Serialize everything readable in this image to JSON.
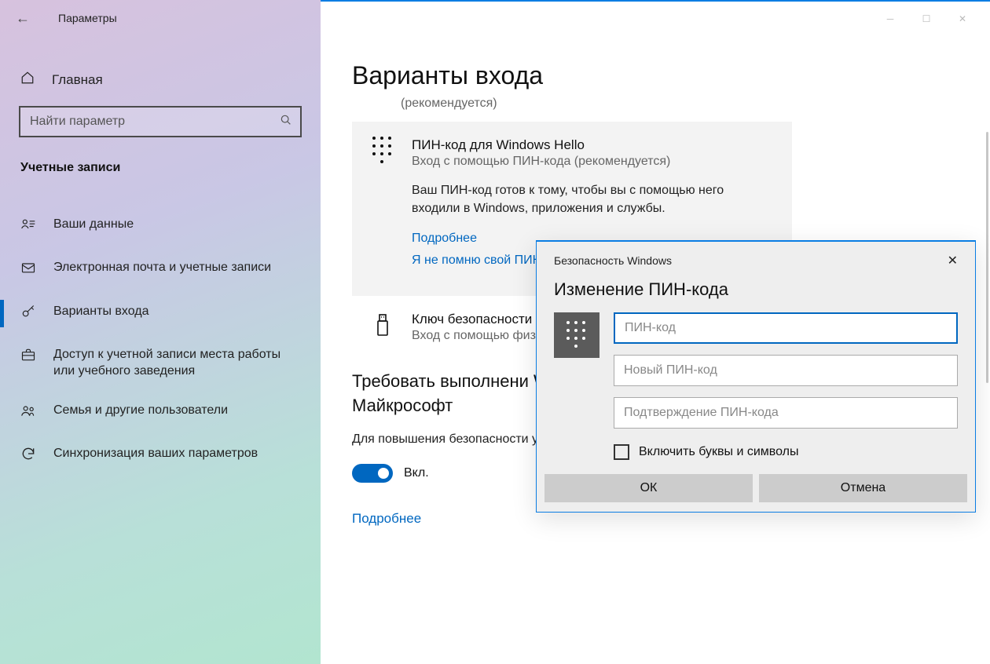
{
  "titlebar": {
    "app_title": "Параметры"
  },
  "sidebar": {
    "home_label": "Главная",
    "search_placeholder": "Найти параметр",
    "section_header": "Учетные записи",
    "items": [
      {
        "label": "Ваши данные"
      },
      {
        "label": "Электронная почта и учетные записи"
      },
      {
        "label": "Варианты входа"
      },
      {
        "label": "Доступ к учетной записи места работы или учебного заведения"
      },
      {
        "label": "Семья и другие пользователи"
      },
      {
        "label": "Синхронизация ваших параметров"
      }
    ]
  },
  "main": {
    "page_title": "Варианты входа",
    "recommended_label": "(рекомендуется)",
    "pin_card": {
      "title": "ПИН-код для Windows Hello",
      "subtitle": "Вход с помощью ПИН-кода (рекомендуется)",
      "description": "Ваш ПИН-код готов к тому, чтобы вы с помощью него входили в Windows, приложения и службы.",
      "learn_more": "Подробнее",
      "forgot_pin": "Я не помню свой ПИН-"
    },
    "security_key": {
      "title": "Ключ безопасности",
      "subtitle": "Вход с помощью физич"
    },
    "require_hello": {
      "title": "Требовать выполнени Windows Hello для уч Майкрософт",
      "description": "Для повышения безопасности учетных записей Майкрософт",
      "toggle_label": "Вкл.",
      "toggle_on": true
    },
    "learn_more_bottom": "Подробнее"
  },
  "modal": {
    "window_title": "Безопасность Windows",
    "heading": "Изменение ПИН-кода",
    "fields": {
      "current_placeholder": "ПИН-код",
      "new_placeholder": "Новый ПИН-код",
      "confirm_placeholder": "Подтверждение ПИН-кода"
    },
    "checkbox_label": "Включить буквы и символы",
    "ok_label": "ОК",
    "cancel_label": "Отмена"
  }
}
